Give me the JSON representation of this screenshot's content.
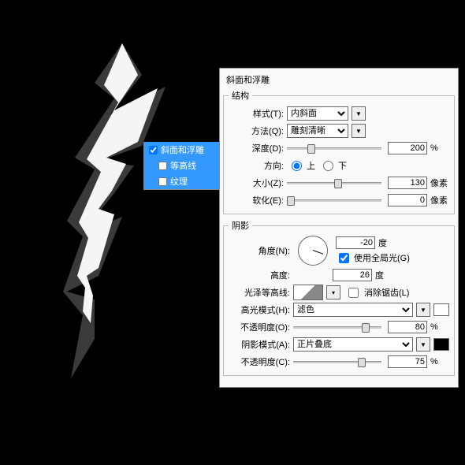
{
  "layers": {
    "bevel": "斜面和浮雕",
    "contour": "等高线",
    "texture": "纹理"
  },
  "panel": {
    "title": "斜面和浮雕",
    "structure": "结构",
    "shadow": "阴影"
  },
  "labels": {
    "style": "样式(T):",
    "technique": "方法(Q):",
    "depth": "深度(D):",
    "direction": "方向:",
    "up": "上",
    "down": "下",
    "size": "大小(Z):",
    "soften": "软化(E):",
    "angle": "角度(N):",
    "globalLight": "使用全局光(G)",
    "altitude": "高度:",
    "glosscontour": "光泽等高线:",
    "antialias": "消除锯齿(L)",
    "highlightmode": "高光模式(H):",
    "opacity1": "不透明度(O):",
    "shadowmode": "阴影模式(A):",
    "opacity2": "不透明度(C):",
    "percent": "%",
    "px": "像素",
    "deg": "度"
  },
  "values": {
    "style": "内斜面",
    "technique": "雕刻清晰",
    "depth": "200",
    "size": "130",
    "soften": "0",
    "angle": "-20",
    "altitude": "26",
    "highlightmode": "滤色",
    "opacity1": "80",
    "shadowmode": "正片叠底",
    "opacity2": "75",
    "directionUp": true,
    "globalLight": true,
    "antialias": false
  }
}
